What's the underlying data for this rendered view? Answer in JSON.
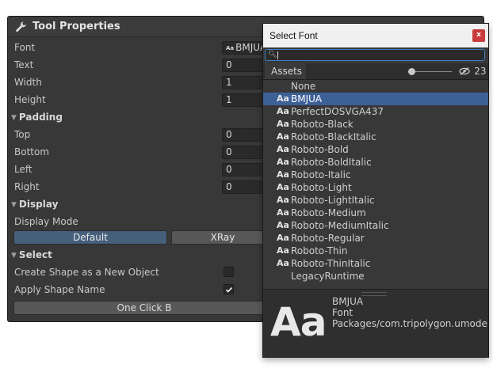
{
  "inspector": {
    "title": "Tool Properties",
    "rows": [
      {
        "label": "Font",
        "value": "BMJUA",
        "kind": "font"
      },
      {
        "label": "Text",
        "value": "0",
        "kind": "field"
      },
      {
        "label": "Width",
        "value": "1",
        "kind": "field"
      },
      {
        "label": "Height",
        "value": "1",
        "kind": "field"
      }
    ],
    "padding": {
      "header": "Padding",
      "rows": [
        {
          "label": "Top",
          "value": "0"
        },
        {
          "label": "Bottom",
          "value": "0"
        },
        {
          "label": "Left",
          "value": "0"
        },
        {
          "label": "Right",
          "value": "0"
        }
      ]
    },
    "display": {
      "header": "Display",
      "mode_label": "Display Mode",
      "default_button": "Default",
      "xray_button": "XRay"
    },
    "select": {
      "header": "Select",
      "create_shape_label": "Create Shape as a New Object",
      "create_shape_checked": false,
      "apply_shape_label": "Apply Shape Name",
      "apply_shape_checked": true,
      "one_click_button": "One Click B"
    },
    "font_prefix": "Aa"
  },
  "font_picker": {
    "title": "Select Font",
    "close_label": "x",
    "search_value": "",
    "search_icon": "search-icon",
    "tab_assets": "Assets",
    "hidden_count": "23",
    "hidden_icon": "eye-slash-icon",
    "item_prefix": "Aa",
    "items": [
      {
        "label": "None",
        "icon": false,
        "selected": false
      },
      {
        "label": "BMJUA",
        "icon": true,
        "selected": true
      },
      {
        "label": "PerfectDOSVGA437",
        "icon": true,
        "selected": false
      },
      {
        "label": "Roboto-Black",
        "icon": true,
        "selected": false
      },
      {
        "label": "Roboto-BlackItalic",
        "icon": true,
        "selected": false
      },
      {
        "label": "Roboto-Bold",
        "icon": true,
        "selected": false
      },
      {
        "label": "Roboto-BoldItalic",
        "icon": true,
        "selected": false
      },
      {
        "label": "Roboto-Italic",
        "icon": true,
        "selected": false
      },
      {
        "label": "Roboto-Light",
        "icon": true,
        "selected": false
      },
      {
        "label": "Roboto-LightItalic",
        "icon": true,
        "selected": false
      },
      {
        "label": "Roboto-Medium",
        "icon": true,
        "selected": false
      },
      {
        "label": "Roboto-MediumItalic",
        "icon": true,
        "selected": false
      },
      {
        "label": "Roboto-Regular",
        "icon": true,
        "selected": false
      },
      {
        "label": "Roboto-Thin",
        "icon": true,
        "selected": false
      },
      {
        "label": "Roboto-ThinItalic",
        "icon": true,
        "selected": false
      },
      {
        "label": "LegacyRuntime",
        "icon": false,
        "selected": false
      }
    ],
    "preview": {
      "glyph": "Aa",
      "name": "BMJUA",
      "type": "Font",
      "path": "Packages/com.tripolygon.umodele"
    }
  },
  "colors": {
    "panel_bg": "#383838",
    "selection": "#3d6197",
    "default_button": "#46607c",
    "close_button": "#c83c3c",
    "search_focus": "#3b7fc4"
  }
}
